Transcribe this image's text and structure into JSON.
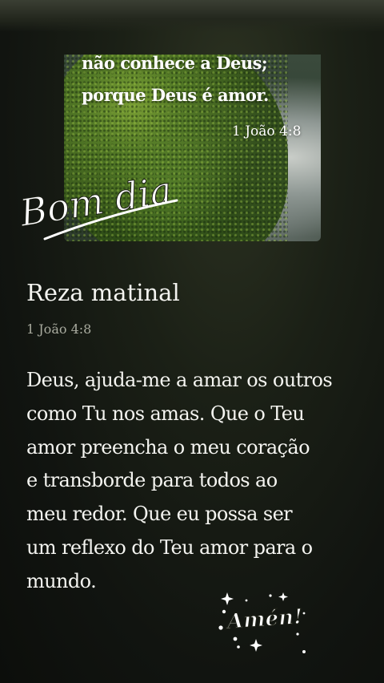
{
  "hero": {
    "verse_line1": "não conhece a Deus;",
    "verse_line2": "porque Deus é amor.",
    "verse_ref": "1 João 4:8",
    "greeting": "Bom dia"
  },
  "post": {
    "title": "Reza matinal",
    "reference": "1 João 4:8",
    "prayer_lines": [
      "Deus, ajuda-me a amar os outros",
      "como Tu nos amas. Que o Teu",
      "amor preencha o meu coração",
      "e transborde para todos ao",
      "meu redor. Que eu possa ser",
      "um reflexo do Teu amor para o",
      "mundo."
    ]
  },
  "sticker": {
    "label": "Amén!"
  },
  "colors": {
    "background": "#14170f",
    "text": "#f4f4f0",
    "muted": "#a9ab9f",
    "moss": "#4e7a24"
  }
}
